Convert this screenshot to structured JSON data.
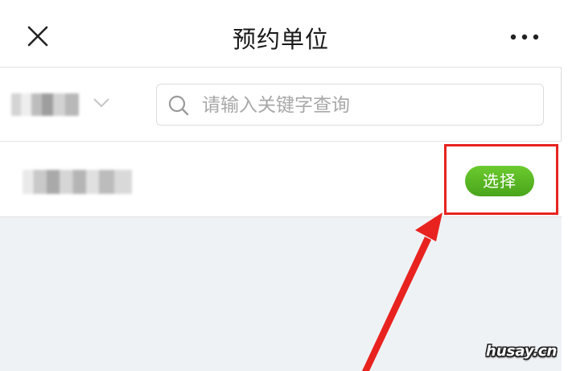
{
  "header": {
    "title": "预约单位",
    "close_icon": "close-icon",
    "more_icon": "more-icon"
  },
  "filter": {
    "selected_value": "",
    "chevron_icon": "chevron-down-icon"
  },
  "search": {
    "placeholder": "请输入关键字查询",
    "value": "",
    "icon": "search-icon"
  },
  "list": {
    "items": [
      {
        "name": "",
        "action_label": "选择"
      }
    ]
  },
  "annotation": {
    "highlight_color": "#e8231f",
    "arrow_color": "#e8231f"
  },
  "colors": {
    "accent_green": "#52b124",
    "background_grey": "#eff2f5"
  },
  "watermark": "husay.cn"
}
